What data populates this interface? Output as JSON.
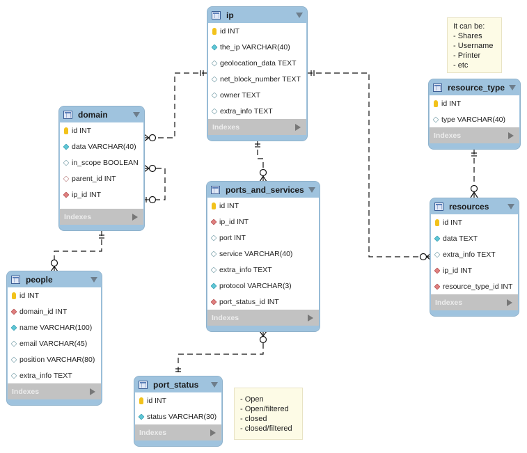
{
  "tables": {
    "ip": {
      "name": "ip",
      "columns": [
        {
          "label": "id INT",
          "icon": "primary-key-icon"
        },
        {
          "label": "the_ip VARCHAR(40)",
          "icon": "not-null-column-icon"
        },
        {
          "label": "geolocation_data TEXT",
          "icon": "column-icon"
        },
        {
          "label": "net_block_number TEXT",
          "icon": "column-icon"
        },
        {
          "label": "owner TEXT",
          "icon": "column-icon"
        },
        {
          "label": "extra_info TEXT",
          "icon": "column-icon"
        }
      ],
      "indexes_label": "Indexes"
    },
    "domain": {
      "name": "domain",
      "columns": [
        {
          "label": "id INT",
          "icon": "primary-key-icon"
        },
        {
          "label": "data VARCHAR(40)",
          "icon": "not-null-column-icon"
        },
        {
          "label": "in_scope BOOLEAN",
          "icon": "column-icon"
        },
        {
          "label": "parent_id INT",
          "icon": "nullable-foreign-key-icon"
        },
        {
          "label": "ip_id INT",
          "icon": "foreign-key-icon"
        }
      ],
      "indexes_label": "Indexes"
    },
    "people": {
      "name": "people",
      "columns": [
        {
          "label": "id INT",
          "icon": "primary-key-icon"
        },
        {
          "label": "domain_id INT",
          "icon": "foreign-key-icon"
        },
        {
          "label": "name VARCHAR(100)",
          "icon": "not-null-column-icon"
        },
        {
          "label": "email VARCHAR(45)",
          "icon": "column-icon"
        },
        {
          "label": "position VARCHAR(80)",
          "icon": "column-icon"
        },
        {
          "label": "extra_info TEXT",
          "icon": "column-icon"
        }
      ],
      "indexes_label": "Indexes"
    },
    "ports_and_services": {
      "name": "ports_and_services",
      "columns": [
        {
          "label": "id INT",
          "icon": "primary-key-icon"
        },
        {
          "label": "ip_id INT",
          "icon": "foreign-key-icon"
        },
        {
          "label": "port INT",
          "icon": "column-icon"
        },
        {
          "label": "service VARCHAR(40)",
          "icon": "column-icon"
        },
        {
          "label": "extra_info TEXT",
          "icon": "column-icon"
        },
        {
          "label": "protocol VARCHAR(3)",
          "icon": "not-null-column-icon"
        },
        {
          "label": "port_status_id INT",
          "icon": "foreign-key-icon"
        }
      ],
      "indexes_label": "Indexes"
    },
    "port_status": {
      "name": "port_status",
      "columns": [
        {
          "label": "id INT",
          "icon": "primary-key-icon"
        },
        {
          "label": "status VARCHAR(30)",
          "icon": "not-null-column-icon"
        }
      ],
      "indexes_label": "Indexes"
    },
    "resource_type": {
      "name": "resource_type",
      "columns": [
        {
          "label": "id INT",
          "icon": "primary-key-icon"
        },
        {
          "label": "type VARCHAR(40)",
          "icon": "column-icon"
        }
      ],
      "indexes_label": "Indexes"
    },
    "resources": {
      "name": "resources",
      "columns": [
        {
          "label": "id INT",
          "icon": "primary-key-icon"
        },
        {
          "label": "data TEXT",
          "icon": "not-null-column-icon"
        },
        {
          "label": "extra_info TEXT",
          "icon": "column-icon"
        },
        {
          "label": "ip_id INT",
          "icon": "foreign-key-icon"
        },
        {
          "label": "resource_type_id INT",
          "icon": "foreign-key-icon"
        }
      ],
      "indexes_label": "Indexes"
    }
  },
  "notes": {
    "resource_types": [
      "It can be:",
      "- Shares",
      "- Username",
      "- Printer",
      "- etc"
    ],
    "port_statuses": [
      "- Open",
      "- Open/filtered",
      "- closed",
      "- closed/filtered"
    ]
  },
  "relationships": [
    {
      "from": "ip",
      "to": "domain",
      "parent_cardinality": "one-and-only-one",
      "child_cardinality": "zero-or-many"
    },
    {
      "from": "domain",
      "to": "domain",
      "parent_cardinality": "zero-or-one",
      "child_cardinality": "zero-or-many"
    },
    {
      "from": "domain",
      "to": "people",
      "parent_cardinality": "one-and-only-one",
      "child_cardinality": "zero-or-many"
    },
    {
      "from": "ip",
      "to": "ports_and_services",
      "parent_cardinality": "one-and-only-one",
      "child_cardinality": "zero-or-many"
    },
    {
      "from": "port_status",
      "to": "ports_and_services",
      "parent_cardinality": "one-and-only-one",
      "child_cardinality": "zero-or-many"
    },
    {
      "from": "ip",
      "to": "resources",
      "parent_cardinality": "one-and-only-one",
      "child_cardinality": "zero-or-many"
    },
    {
      "from": "resource_type",
      "to": "resources",
      "parent_cardinality": "one-and-only-one",
      "child_cardinality": "zero-or-many"
    }
  ],
  "colors": {
    "header": "#9fc3de",
    "indexes_bar": "#c2c2c2",
    "note_bg": "#fdfbe6",
    "link_line": "#111111"
  }
}
